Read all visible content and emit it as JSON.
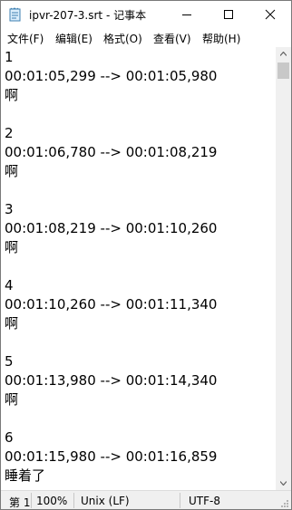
{
  "window": {
    "title": "ipvr-207-3.srt - 记事本",
    "app_icon": "notepad-icon"
  },
  "menu": [
    "文件(F)",
    "编辑(E)",
    "格式(O)",
    "查看(V)",
    "帮助(H)"
  ],
  "content_lines": [
    "1",
    "00:01:05,299 --> 00:01:05,980",
    "啊",
    "",
    "2",
    "00:01:06,780 --> 00:01:08,219",
    "啊",
    "",
    "3",
    "00:01:08,219 --> 00:01:10,260",
    "啊",
    "",
    "4",
    "00:01:10,260 --> 00:01:11,340",
    "啊",
    "",
    "5",
    "00:01:13,980 --> 00:01:14,340",
    "啊",
    "",
    "6",
    "00:01:15,980 --> 00:01:16,859",
    "睡着了"
  ],
  "status": {
    "position": "第 1",
    "zoom": "100%",
    "line_ending": "Unix (LF)",
    "encoding": "UTF-8"
  }
}
